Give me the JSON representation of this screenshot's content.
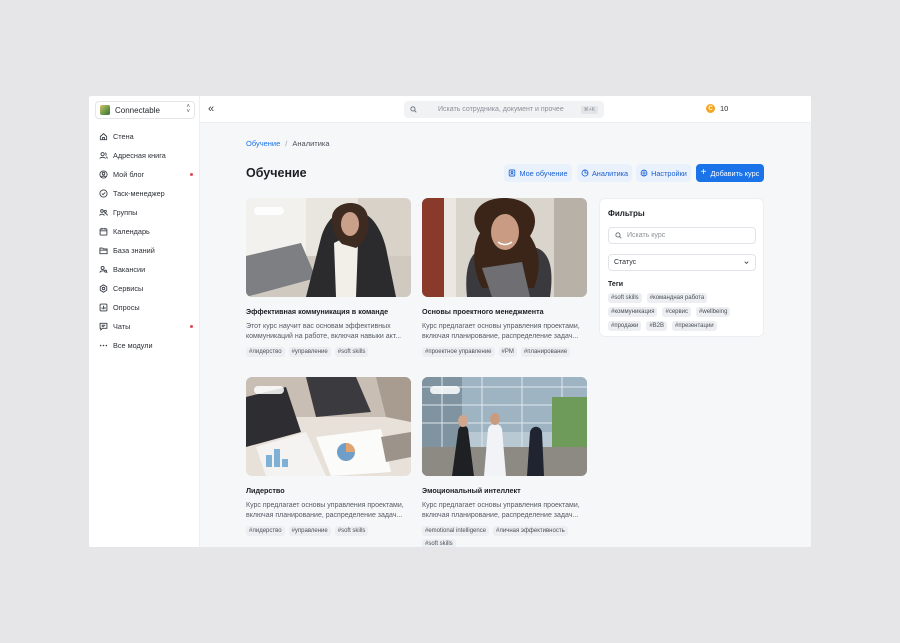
{
  "workspace": {
    "name": "Connectable"
  },
  "sidebar": {
    "items": [
      {
        "label": "Стена",
        "icon": "home-icon",
        "dot": false
      },
      {
        "label": "Адресная книга",
        "icon": "users-icon",
        "dot": false
      },
      {
        "label": "Мой блог",
        "icon": "user-circle-icon",
        "dot": true
      },
      {
        "label": "Таск-менеджер",
        "icon": "check-circle-icon",
        "dot": false
      },
      {
        "label": "Группы",
        "icon": "group-icon",
        "dot": false
      },
      {
        "label": "Календарь",
        "icon": "calendar-icon",
        "dot": false
      },
      {
        "label": "База знаний",
        "icon": "folder-icon",
        "dot": false
      },
      {
        "label": "Вакансии",
        "icon": "user-search-icon",
        "dot": false
      },
      {
        "label": "Сервисы",
        "icon": "services-icon",
        "dot": false
      },
      {
        "label": "Опросы",
        "icon": "poll-icon",
        "dot": false
      },
      {
        "label": "Чаты",
        "icon": "chat-icon",
        "dot": true
      },
      {
        "label": "Все модули",
        "icon": "dots-icon",
        "dot": false
      }
    ]
  },
  "topbar": {
    "search_placeholder": "Искать сотрудника, документ и прочее",
    "shortcut": "⌘+K",
    "coins": "10",
    "coin_symbol": "C"
  },
  "breadcrumb": {
    "parent": "Обучение",
    "separator": "/",
    "current": "Аналитика"
  },
  "page": {
    "title": "Обучение"
  },
  "actions": {
    "my_learning": "Мое обучение",
    "analytics": "Аналитика",
    "settings": "Настройки",
    "add_course": "Добавить курс"
  },
  "courses": [
    {
      "title": "Эффективная коммуникация в команде",
      "description": "Этот курс научит вас основам эффективных коммуникаций на работе, включая навыки акт...",
      "tags": [
        "#лидерство",
        "#управление",
        "#soft skills"
      ]
    },
    {
      "title": "Основы проектного менеджмента",
      "description": "Курс предлагает основы управления проектами, включая планирование, распределение задач...",
      "tags": [
        "#проектное управление",
        "#PM",
        "#планирование"
      ]
    },
    {
      "title": "Лидерство",
      "description": "Курс предлагает основы управления проектами, включая планирование, распределение задач...",
      "tags": [
        "#лидерство",
        "#управление",
        "#soft skills"
      ]
    },
    {
      "title": "Эмоциональный интеллект",
      "description": "Курс предлагает основы управления проектами, включая планирование, распределение задач...",
      "tags": [
        "#emotional intelligence",
        "#личная эффективность",
        "#soft skills"
      ]
    }
  ],
  "filters": {
    "title": "Фильтры",
    "search_placeholder": "Искать курс",
    "status_label": "Статус",
    "tags_title": "Теги",
    "tags": [
      "#soft skills",
      "#командная работа",
      "#коммуникация",
      "#сервис",
      "#wellbeing",
      "#продажи",
      "#B2B",
      "#презентации"
    ]
  },
  "colors": {
    "accent": "#1a73e8",
    "accent_light": "#e9f1fd",
    "notification_dot": "#e5484d",
    "coin": "#f5a524"
  }
}
